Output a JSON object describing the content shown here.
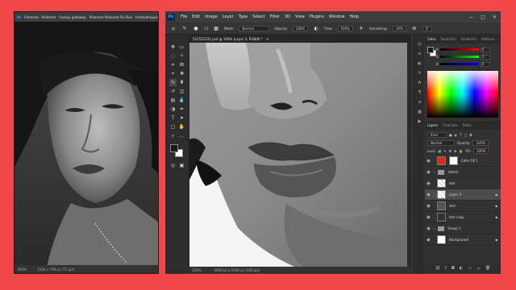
{
  "ref_window": {
    "title": "Ps",
    "tabs": [
      "Pinterest · Pinterest",
      "lindsey galloway",
      "Pinterest Pinterest Pin Poin",
      "trellisotheque"
    ],
    "zoom": "100%",
    "size": "1028 x 709 px (72 ppi)"
  },
  "app": {
    "logo": "Ps",
    "menu": [
      "File",
      "Edit",
      "Image",
      "Layer",
      "Type",
      "Select",
      "Filter",
      "3D",
      "View",
      "Plugins",
      "Window",
      "Help"
    ],
    "window_controls": [
      "—",
      "□",
      "✕"
    ]
  },
  "options_bar": {
    "brush_size": "13",
    "mode_label": "Mode:",
    "mode_value": "Normal",
    "opacity_label": "Opacity:",
    "opacity_value": "100%",
    "flow_label": "Flow:",
    "flow_value": "100%",
    "smoothing_label": "Smoothing:",
    "smoothing_value": "10%",
    "angle_value": "0°"
  },
  "document": {
    "tab_title": "522522331.psd @ 100% (Layer 3, RGB/8) *",
    "close": "✕",
    "zoom": "100%",
    "size": "4000 px x 5000 px (300 ppi)"
  },
  "color_panel": {
    "tabs": [
      "Color",
      "Swatches",
      "Gradients",
      "Patterns"
    ],
    "active_tab": "Color",
    "fg_color": "#1a1a1a",
    "bg_color": "#ffffff",
    "r_value": "0",
    "g_value": "0",
    "b_value": "0"
  },
  "layers_panel": {
    "tabs": [
      "Layers",
      "Channels",
      "Paths"
    ],
    "active_tab": "Layers",
    "search_label": "Kind",
    "blend_mode": "Normal",
    "opacity_label": "Opacity:",
    "opacity_value": "100%",
    "lock_label": "Lock:",
    "fill_label": "Fill:",
    "fill_value": "100%",
    "layers": [
      {
        "name": "Color Fill 1",
        "kind": "fill",
        "visible": true,
        "selected": false
      },
      {
        "name": "sketch",
        "kind": "group",
        "visible": true,
        "selected": false
      },
      {
        "name": "hair",
        "kind": "layer",
        "visible": true,
        "selected": false
      },
      {
        "name": "Layer 3",
        "kind": "layer",
        "visible": true,
        "selected": true
      },
      {
        "name": "skin",
        "kind": "layer",
        "visible": true,
        "selected": false
      },
      {
        "name": "hair copy",
        "kind": "layer",
        "visible": true,
        "selected": false
      },
      {
        "name": "Group 1",
        "kind": "group",
        "visible": true,
        "selected": false
      },
      {
        "name": "Background",
        "kind": "layer",
        "visible": true,
        "selected": false
      }
    ]
  },
  "colors": {
    "frame_background": "#f0474a",
    "accent_fill": "#e0271e"
  }
}
